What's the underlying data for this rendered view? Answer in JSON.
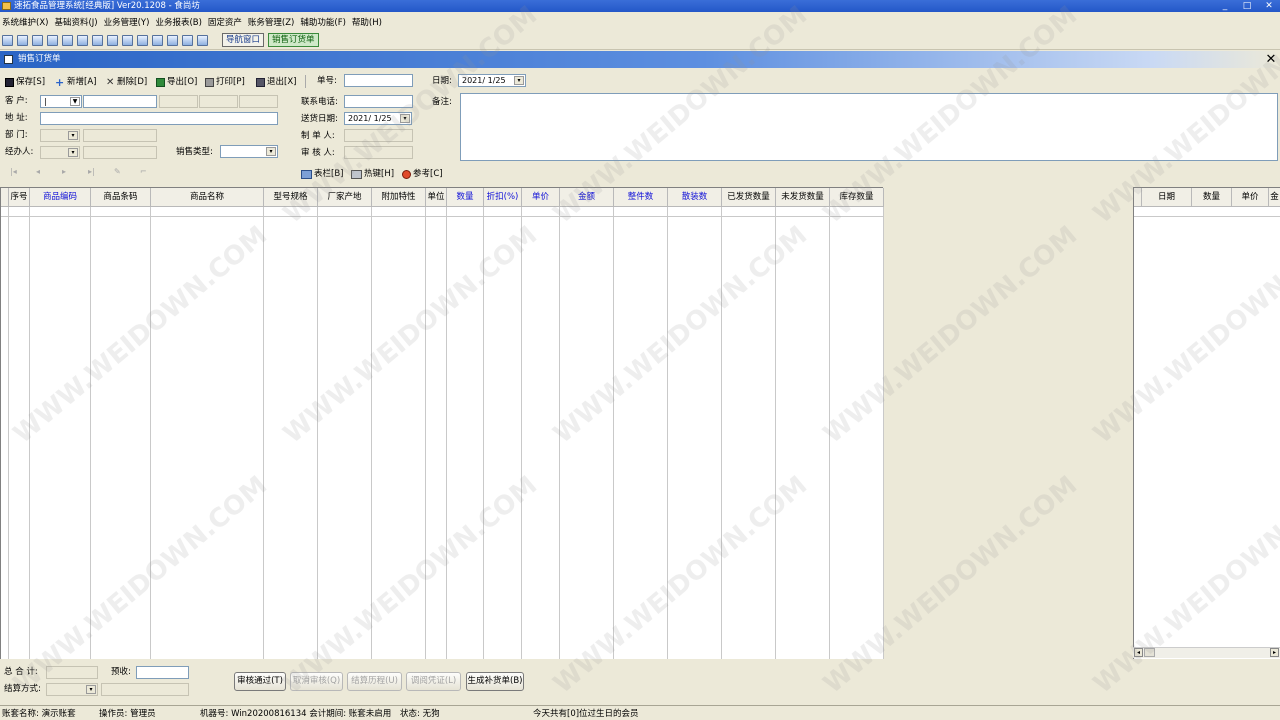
{
  "window": {
    "title": "速拓食品管理系统[经典版] Ver20.1208 - 食尚坊",
    "controls": [
      "_",
      "□",
      "✕"
    ]
  },
  "menu": [
    "系统维护(X)",
    "基础资料(J)",
    "业务管理(Y)",
    "业务报表(B)",
    "固定资产",
    "账务管理(Z)",
    "辅助功能(F)",
    "帮助(H)"
  ],
  "toolbar": {
    "nav_button": "导航窗口",
    "active_button": "销售订货单"
  },
  "form": {
    "caption": "销售订货单",
    "close_glyph": "✕",
    "buttons": {
      "save": "保存[S]",
      "add": "新增[A]",
      "delete": "删除[D]",
      "export": "导出[O]",
      "print": "打印[P]",
      "exit": "退出[X]"
    },
    "order_no_label": "单号:",
    "order_no": "",
    "date_label": "日期:",
    "date": "2021/ 1/25",
    "customer_label": "客  户:",
    "customer": "|",
    "address_label": "地  址:",
    "dept_label": "部  门:",
    "handler_label": "经办人:",
    "sales_type_label": "销售类型:",
    "phone_label": "联系电话:",
    "delivery_date_label": "送货日期:",
    "delivery_date": "2021/ 1/25",
    "maker_label": "制 单 人:",
    "reviewer_label": "审 核 人:",
    "remark_label": "备注:",
    "grid_tools": {
      "columns": "表栏[B]",
      "hotkeys": "热键[H]",
      "reference": "参考[C]"
    },
    "nav_glyphs": [
      "|◂",
      "◂",
      "▸",
      "▸|",
      "✎",
      "⌐"
    ]
  },
  "grid": {
    "columns": [
      {
        "label": "序号",
        "blue": false
      },
      {
        "label": "商品编码",
        "blue": true
      },
      {
        "label": "商品条码",
        "blue": false
      },
      {
        "label": "商品名称",
        "blue": false
      },
      {
        "label": "型号规格",
        "blue": false
      },
      {
        "label": "厂家产地",
        "blue": false
      },
      {
        "label": "附加特性",
        "blue": false
      },
      {
        "label": "单位",
        "blue": false
      },
      {
        "label": "数量",
        "blue": true
      },
      {
        "label": "折扣(%)",
        "blue": true
      },
      {
        "label": "单价",
        "blue": true
      },
      {
        "label": "金额",
        "blue": true
      },
      {
        "label": "整件数",
        "blue": true
      },
      {
        "label": "散装数",
        "blue": true
      },
      {
        "label": "已发货数量",
        "blue": false
      },
      {
        "label": "未发货数量",
        "blue": false
      },
      {
        "label": "库存数量",
        "blue": false
      }
    ],
    "history_columns": [
      "日期",
      "数量",
      "单价",
      "金"
    ]
  },
  "footer": {
    "total_label": "总 合 计:",
    "prepay_label": "预收:",
    "settle_label": "结算方式:",
    "buttons": [
      {
        "label": "审核通过(T)",
        "enabled": true
      },
      {
        "label": "取消审核(Q)",
        "enabled": false
      },
      {
        "label": "结算历程(U)",
        "enabled": false
      },
      {
        "label": "调阅凭证(L)",
        "enabled": false
      },
      {
        "label": "生成补货单(B)",
        "enabled": true
      }
    ]
  },
  "status": {
    "account": "账套名称: 演示账套",
    "operator": "操作员: 管理员",
    "machine": "机器号: Win20200816134 会计期间: 账套未启用",
    "state": "状态: 无狗",
    "birthday": "今天共有[0]位过生日的会员"
  },
  "watermark": "WWW.WEIDOWN.COM"
}
